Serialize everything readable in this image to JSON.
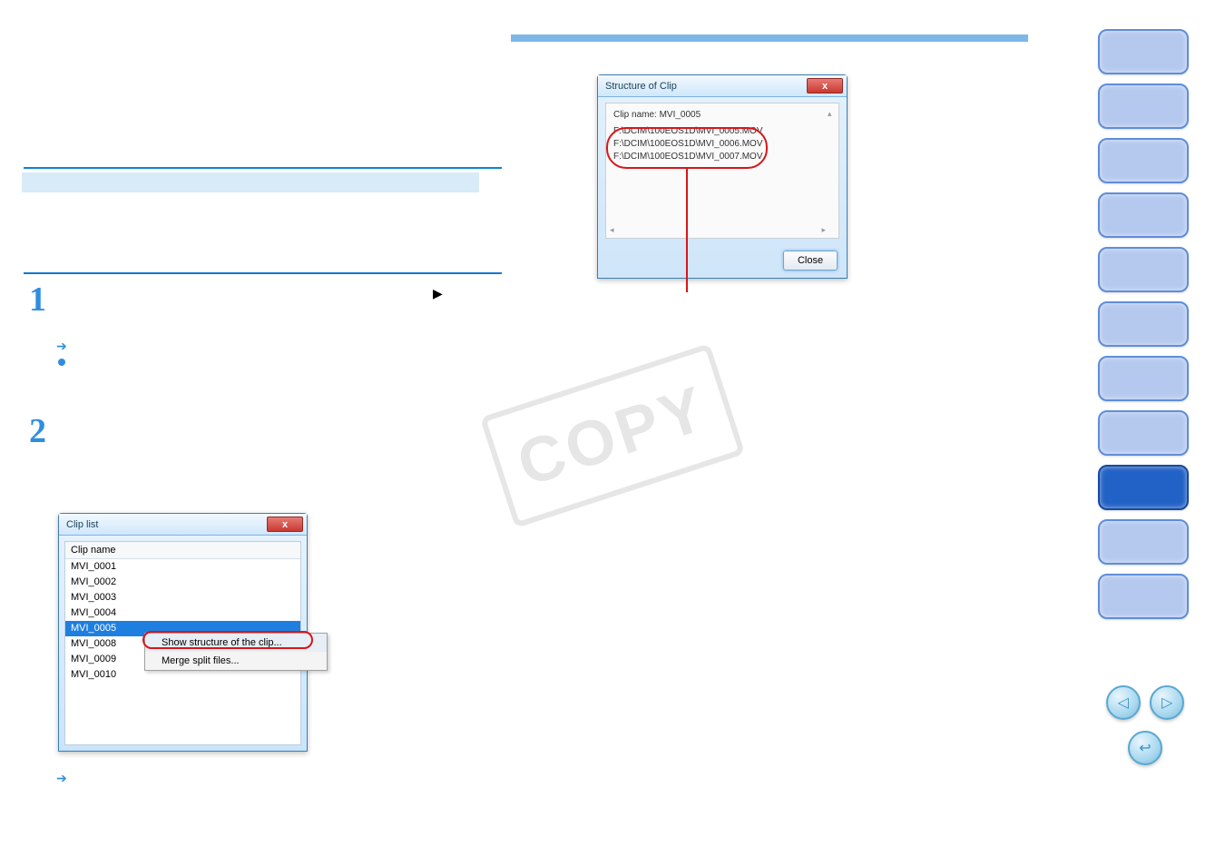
{
  "watermark": "COPY",
  "clipList": {
    "title": "Clip list",
    "columnHeader": "Clip name",
    "rows": [
      "MVI_0001",
      "MVI_0002",
      "MVI_0003",
      "MVI_0004",
      "MVI_0005",
      "MVI_0008",
      "MVI_0009",
      "MVI_0010"
    ],
    "selected": "MVI_0005",
    "closeX": "x"
  },
  "contextMenu": {
    "showStructure": "Show structure of the clip...",
    "mergeSplit": "Merge split files..."
  },
  "structDialog": {
    "title": "Structure of Clip",
    "clipNameLabel": "Clip name: MVI_0005",
    "paths": [
      "F:\\DCIM\\100EOS1D\\MVI_0005.MOV",
      "F:\\DCIM\\100EOS1D\\MVI_0006.MOV",
      "F:\\DCIM\\100EOS1D\\MVI_0007.MOV"
    ],
    "closeBtn": "Close",
    "closeX": "x"
  },
  "icons": {
    "play": "▶",
    "arrowRight": "➔",
    "prev": "◁",
    "next": "▷",
    "return": "↩",
    "scrollLeft": "◂",
    "scrollRight": "▸",
    "scrollUp": "▴"
  },
  "steps": {
    "one": "1",
    "two": "2"
  }
}
